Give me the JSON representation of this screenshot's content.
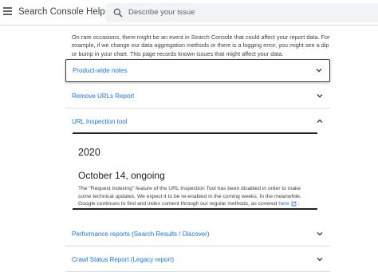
{
  "header": {
    "title": "Search Console Help",
    "search_placeholder": "Describe your issue"
  },
  "intro_text": "On rare occasions, there might be an event in Search Console that could affect your report data. For example, if we change our data aggregation methods or there is a logging error, you might see a dip or bump in your chart. This page records known issues that might affect your data.",
  "accordion": [
    {
      "label": "Product-wide notes",
      "expanded": false
    },
    {
      "label": "Remove URLs Report",
      "expanded": false
    },
    {
      "label": "URL Inspection tool",
      "expanded": true
    },
    {
      "label": "Performance reports (Search Results / Discover)",
      "expanded": false
    },
    {
      "label": "Crawl Status Report (Legacy report)",
      "expanded": false
    }
  ],
  "url_inspection": {
    "year": "2020",
    "date": "October 14, ongoing",
    "note": "The \"Request Indexing\" feature of the URL Inspection Tool has been disabled in order to make some technical updates. We expect it to be re-enabled in the coming weeks. In the meanwhile, Google continues to find and index content through our regular methods, as covered",
    "link_text": "here",
    "note_end": "."
  },
  "colors": {
    "link": "#1a73e8",
    "text": "#202124",
    "divider": "#dadce0"
  }
}
